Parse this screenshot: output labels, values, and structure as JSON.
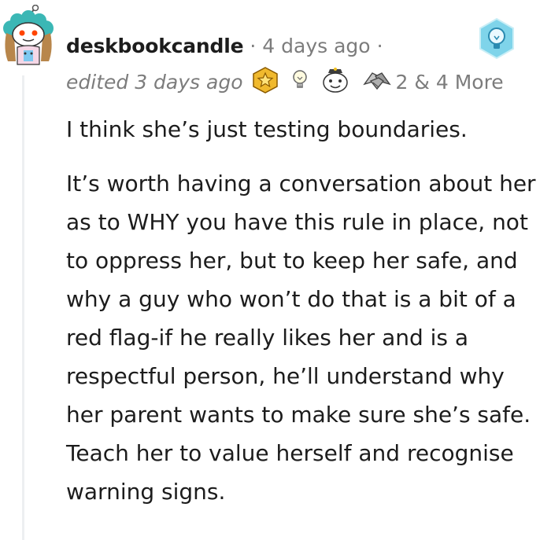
{
  "comment": {
    "username": "deskbookcandle",
    "separator": "·",
    "timestamp": "4 days ago",
    "trailing_separator": "·",
    "edited": "edited 3 days ago",
    "awards": [
      {
        "icon": "gold-star-award-icon"
      },
      {
        "icon": "lightbulb-award-icon"
      },
      {
        "icon": "wholesome-face-award-icon"
      },
      {
        "icon": "handshake-award-icon"
      }
    ],
    "award_count": "2",
    "more_awards": "& 4 More",
    "flair_icon": "blue-lightbulb-badge-icon",
    "paragraphs": [
      "I think she’s just testing boundaries.",
      "It’s worth having a conversation about her as to WHY you have this rule in place, not to oppress her, but to keep her safe, and why a guy who won’t do that is a bit of a red flag-if he really likes her and is a respectful person, he’ll understand why her parent wants to make sure she’s safe. Teach her to value herself and recognise warning signs."
    ]
  },
  "colors": {
    "text": "#1c1c1c",
    "meta": "#7c7c7c",
    "thread_line": "#edeff1",
    "badge": "#7fd4ea"
  }
}
